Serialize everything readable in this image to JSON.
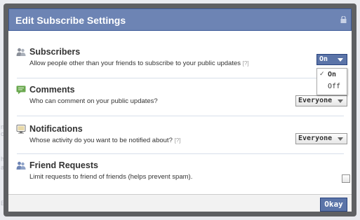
{
  "dialog": {
    "title": "Edit Subscribe Settings"
  },
  "settings": {
    "subscribers": {
      "title": "Subscribers",
      "description": "Allow people other than your friends to subscribe to your public updates",
      "help": "[?]",
      "value": "On",
      "options": [
        "On",
        "Off"
      ],
      "icon": "people-icon"
    },
    "comments": {
      "title": "Comments",
      "description": "Who can comment on your public updates?",
      "value": "Everyone",
      "icon": "speech-bubble-icon"
    },
    "notifications": {
      "title": "Notifications",
      "description": "Whose activity do you want to be notified about?",
      "help": "[?]",
      "value": "Everyone",
      "icon": "monitor-icon"
    },
    "friend_requests": {
      "title": "Friend Requests",
      "description": "Limit requests to friend of friends (helps prevent spam).",
      "checked": false,
      "icon": "friends-icon"
    }
  },
  "footer": {
    "okay_label": "Okay"
  },
  "colors": {
    "header": "#6d84b4",
    "button": "#5b74a8",
    "comment_icon": "#6aa84f"
  }
}
